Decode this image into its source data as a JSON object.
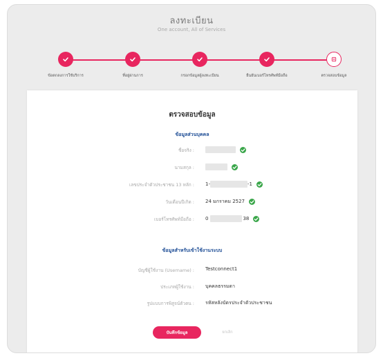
{
  "header": {
    "title": "ลงทะเบียน",
    "subtitle": "One account, All of Services"
  },
  "steps": [
    {
      "label": "ข้อตกลงการใช้บริการ",
      "status": "done"
    },
    {
      "label": "ที่อยู่ผ่านการ",
      "status": "done"
    },
    {
      "label": "กรอกข้อมูลผู้ลงทะเบียน",
      "status": "done"
    },
    {
      "label": "ยืนยันเบอร์โทรศัพท์มือถือ",
      "status": "done"
    },
    {
      "label": "ตรวจสอบข้อมูล",
      "status": "current"
    }
  ],
  "colors": {
    "accent": "#e8265f",
    "check": "#3aa64a",
    "section": "#1f4e96"
  },
  "card": {
    "title": "ตรวจสอบข้อมูล",
    "personal_section": "ข้อมูลส่วนบุคคล",
    "personal_fields": [
      {
        "label": "ชื่อจริง :",
        "value": "",
        "verified": true
      },
      {
        "label": "นามสกุล :",
        "value": "",
        "verified": true
      },
      {
        "label": "เลขประจำตัวประชาชน 13 หลัก :",
        "prefix": "1-",
        "suffix": "-1",
        "verified": true
      },
      {
        "label": "วันเดือนปีเกิด :",
        "value": "24 มกราคม 2527",
        "verified": true
      },
      {
        "label": "เบอร์โทรศัพท์มือถือ :",
        "prefix": "0",
        "suffix": "38",
        "verified": true
      }
    ],
    "account_section": "ข้อมูลสำหรับเข้าใช้งานระบบ",
    "account_fields": [
      {
        "label": "บัญชีผู้ใช้งาน (Username) :",
        "value": "Testconnect1"
      },
      {
        "label": "ประเภทผู้ใช้งาน :",
        "value": "บุคคลธรรมดา"
      },
      {
        "label": "รูปแบบการพิสูจน์ตัวตน :",
        "value": "รหัสหลังบัตรประจำตัวประชาชน"
      }
    ],
    "save_label": "บันทึกข้อมูล",
    "cancel_label": "ยกเลิก"
  }
}
